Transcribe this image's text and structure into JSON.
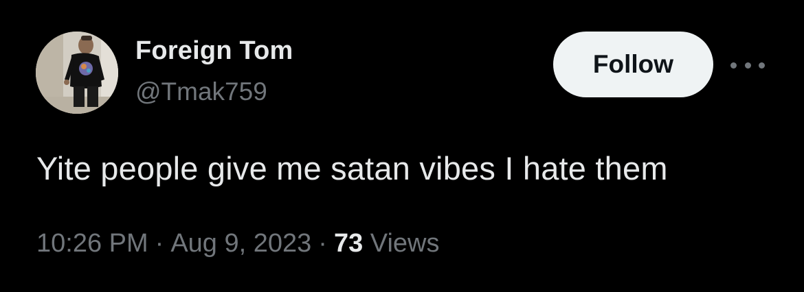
{
  "author": {
    "display_name": "Foreign Tom",
    "handle": "@Tmak759"
  },
  "actions": {
    "follow_label": "Follow",
    "more_icon": "more-horizontal-icon"
  },
  "tweet": {
    "text": "Yite people give me satan vibes I hate them",
    "time": "10:26 PM",
    "date": "Aug 9, 2023",
    "separator": "·",
    "view_count": "73",
    "views_label": "Views"
  },
  "colors": {
    "background": "#000000",
    "primary_text": "#e7e9ea",
    "secondary_text": "#71767b",
    "follow_button_bg": "#eff3f4",
    "follow_button_text": "#0f1419"
  }
}
